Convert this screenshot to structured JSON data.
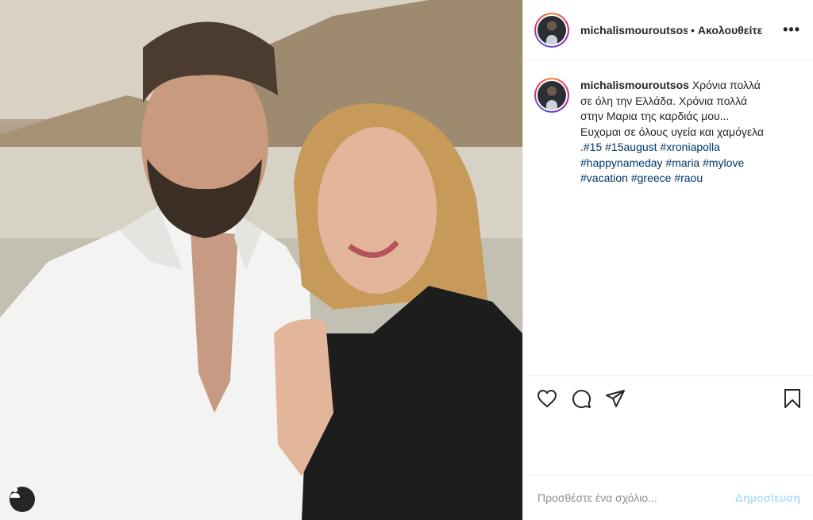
{
  "post": {
    "username": "michalismouroutsos",
    "following_label": "Ακολουθείτε",
    "separator": "•",
    "more_label": "•••",
    "caption": {
      "username": "michalismouroutsos",
      "text": "Χρόνια πολλά σε όλη την Ελλάδα. Χρόνια πολλά στην Μαρια της καρδιάς μου... Ευχομαι σε όλους υγεία και χαμόγελα .",
      "hashtags": [
        "#15",
        "#15august",
        "#xroniapolla",
        "#happynameday",
        "#maria",
        "#mylove",
        "#vacation",
        "#greece",
        "#raou"
      ]
    }
  },
  "comment": {
    "placeholder": "Προσθέστε ένα σχόλιο...",
    "post_label": "Δημοσίευση"
  },
  "icons": {
    "like": "heart-icon",
    "comment": "comment-icon",
    "share": "paper-plane-icon",
    "save": "bookmark-icon",
    "user_tag": "person-icon"
  },
  "colors": {
    "hashtag": "#00376b",
    "post_button_disabled": "#b2dffc",
    "divider": "#efefef"
  }
}
